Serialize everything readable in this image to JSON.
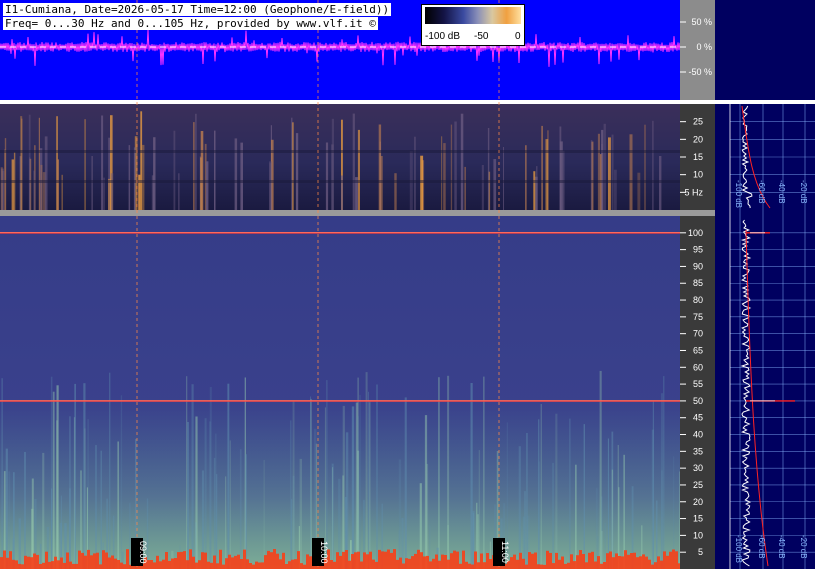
{
  "header": {
    "line1": "I1-Cumiana, Date=2026-05-17 Time=12:00 (Geophone/E-field))",
    "line2": "Freq= 0...30 Hz and 0...105 Hz, provided by www.vlf.it ©"
  },
  "colorbar": {
    "labels": [
      "-100 dB",
      "-50",
      "0"
    ],
    "colors": [
      "#000000",
      "#141446",
      "#3a4aa0",
      "#d9c8a0",
      "#f0a040",
      "#ffe0a0"
    ]
  },
  "colors": {
    "waveform_bg": "#0000ff",
    "waveform_trace": "#ff33ff",
    "spectrogram_bg": "#3b3f86",
    "grid_line": "#8ab8ff",
    "time_marker": "#ff8844",
    "mains_line": "#ff3333",
    "right_panel_bg": "#000060",
    "spectrum_curve": "#ffffff",
    "model_curve": "#ff2222"
  },
  "chart_data": [
    {
      "type": "line",
      "name": "waveform",
      "ylabel_ticks": [
        "50 %",
        "0 %",
        "-50 %"
      ],
      "y_values": [
        50,
        0,
        -50
      ],
      "ylim": [
        -100,
        100
      ]
    },
    {
      "type": "heatmap",
      "name": "spectrogram-0-30Hz",
      "y_ticks": [
        5,
        10,
        15,
        20,
        25
      ],
      "y_tick_labels": [
        "5 Hz",
        "10",
        "15",
        "20",
        "25"
      ],
      "ylim": [
        0,
        30
      ],
      "time_markers": [
        "09:00",
        "10:00",
        "11:00"
      ]
    },
    {
      "type": "heatmap",
      "name": "spectrogram-0-105Hz",
      "y_ticks": [
        5,
        10,
        15,
        20,
        25,
        30,
        35,
        40,
        45,
        50,
        55,
        60,
        65,
        70,
        75,
        80,
        85,
        90,
        95,
        100
      ],
      "y_tick_labels": [
        "5",
        "10",
        "15",
        "20",
        "25",
        "30",
        "35",
        "40",
        "45",
        "50",
        "55",
        "60",
        "65",
        "70",
        "75",
        "80",
        "85",
        "90",
        "95",
        "100"
      ],
      "ylim": [
        0,
        105
      ],
      "highlighted_lines_hz": [
        50,
        100
      ],
      "time_markers": [
        "09:00",
        "10:00",
        "11:00"
      ]
    },
    {
      "type": "line",
      "name": "spectrum-profile-top",
      "x_tick_labels": [
        "-100 dB",
        "-60 dB",
        "-40 dB",
        "-20 dB"
      ]
    },
    {
      "type": "line",
      "name": "spectrum-profile-bottom",
      "x_tick_labels": [
        "-100 dB",
        "-60 dB",
        "-40 dB",
        "-20 dB"
      ],
      "peaks_hz": [
        50,
        100
      ]
    }
  ],
  "time_labels": [
    "09:00",
    "10:00",
    "11:00"
  ]
}
